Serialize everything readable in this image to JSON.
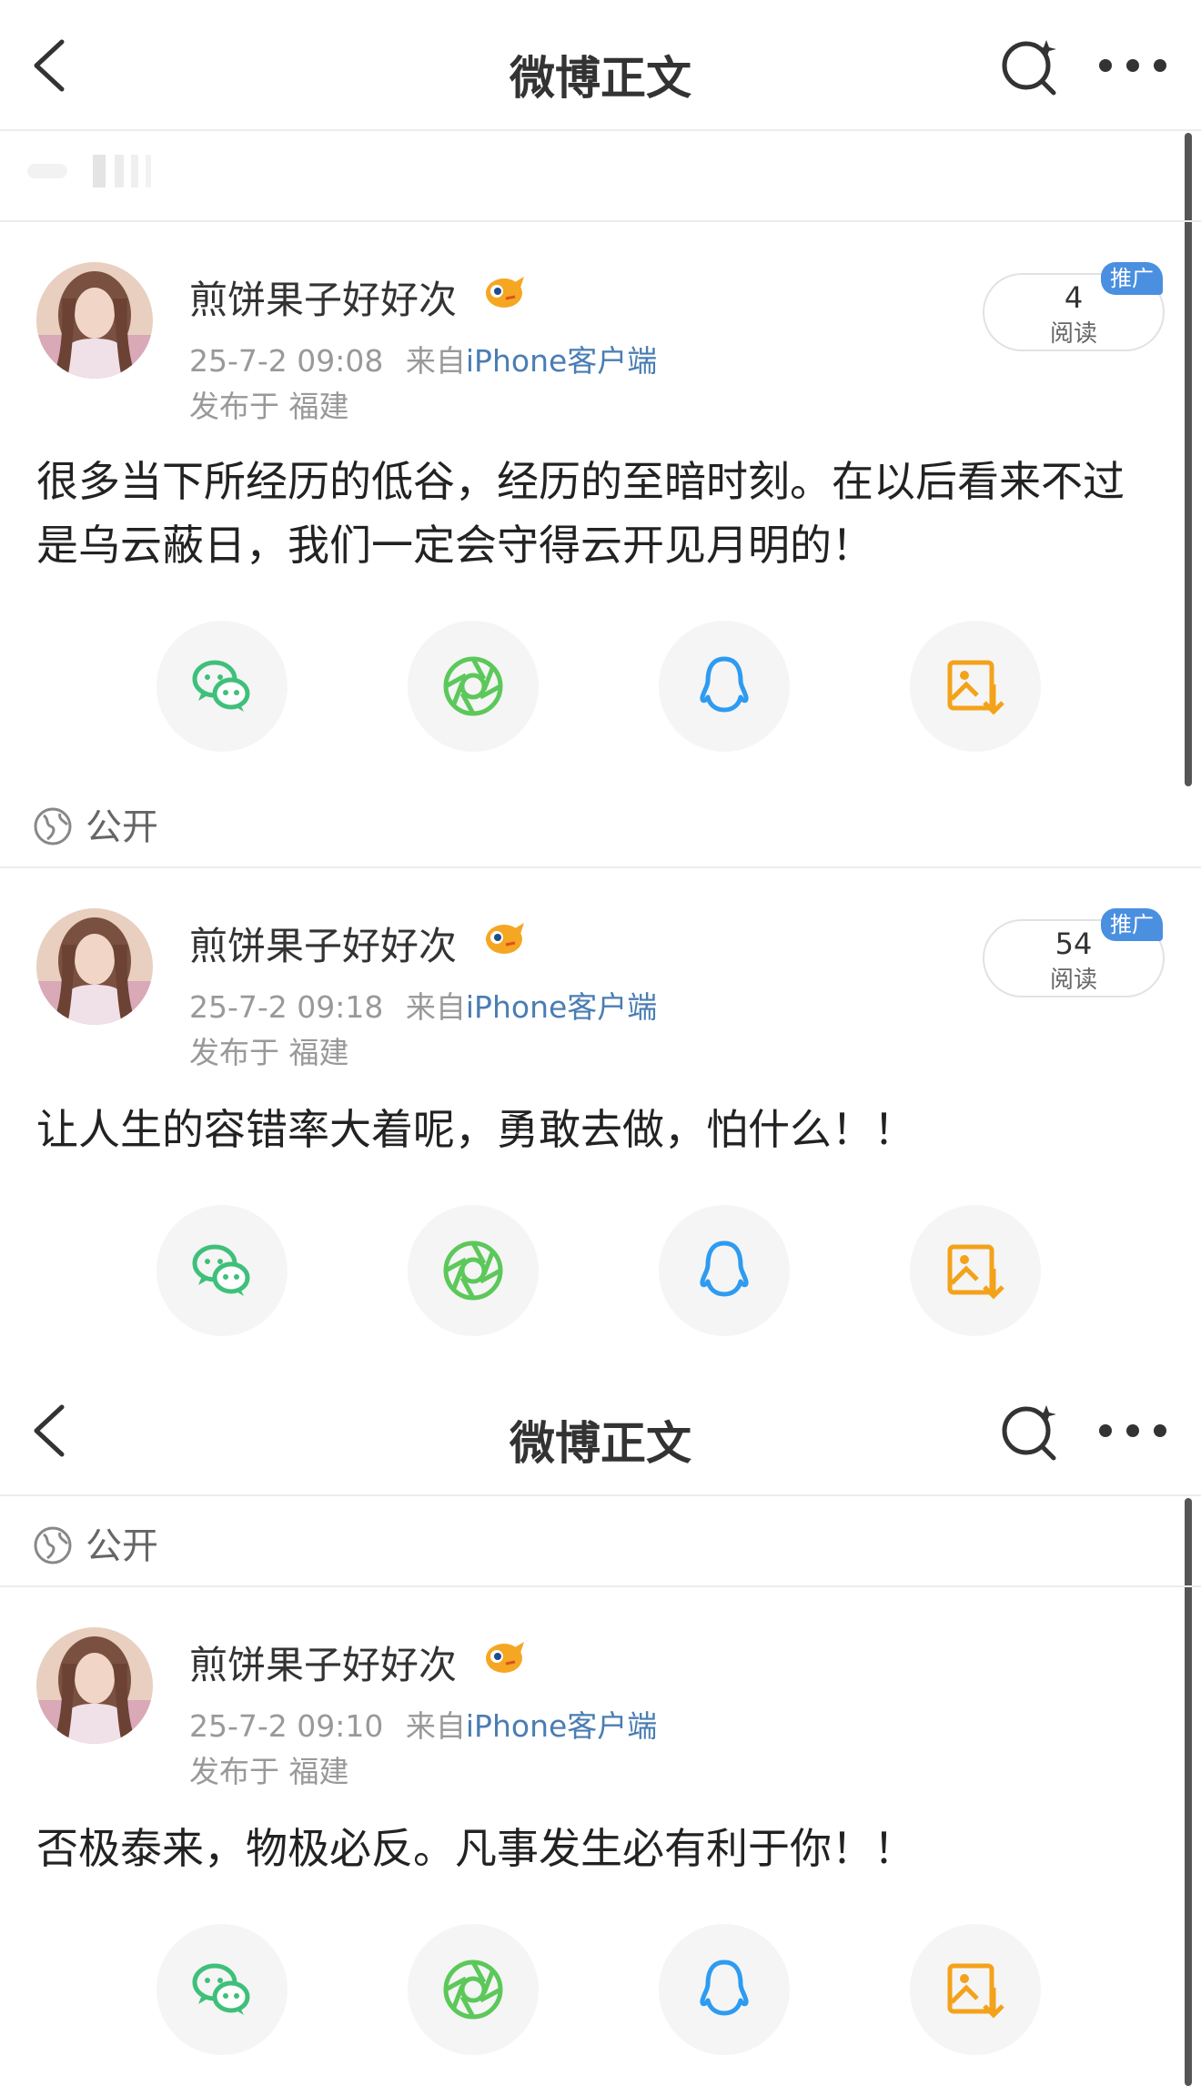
{
  "nav": {
    "title": "微博正文"
  },
  "privacy_label": "公开",
  "posts": [
    {
      "username": "煎饼果子好好次",
      "time": "25-7-2 09:08",
      "source_prefix": "来自",
      "source": "iPhone客户端",
      "location": "发布于 福建",
      "reads": "4",
      "reads_label": "阅读",
      "promo": "推广",
      "text": "很多当下所经历的低谷，经历的至暗时刻。在以后看来不过是乌云蔽日，我们一定会守得云开见月明的！"
    },
    {
      "username": "煎饼果子好好次",
      "time": "25-7-2 09:18",
      "source_prefix": "来自",
      "source": "iPhone客户端",
      "location": "发布于 福建",
      "reads": "54",
      "reads_label": "阅读",
      "promo": "推广",
      "text": "让人生的容错率大着呢，勇敢去做，怕什么！！"
    },
    {
      "username": "煎饼果子好好次",
      "time": "25-7-2 09:10",
      "source_prefix": "来自",
      "source": "iPhone客户端",
      "location": "发布于 福建",
      "text": "否极泰来，物极必反。凡事发生必有利于你！！"
    }
  ],
  "share_icons": [
    "wechat-icon",
    "moments-icon",
    "qq-icon",
    "save-image-icon"
  ],
  "colors": {
    "wechat": "#3fc07a",
    "moments": "#5cc85a",
    "qq": "#2e9bf0",
    "save": "#f3a21a",
    "link": "#4a7db3",
    "promo": "#4a8fe0"
  }
}
